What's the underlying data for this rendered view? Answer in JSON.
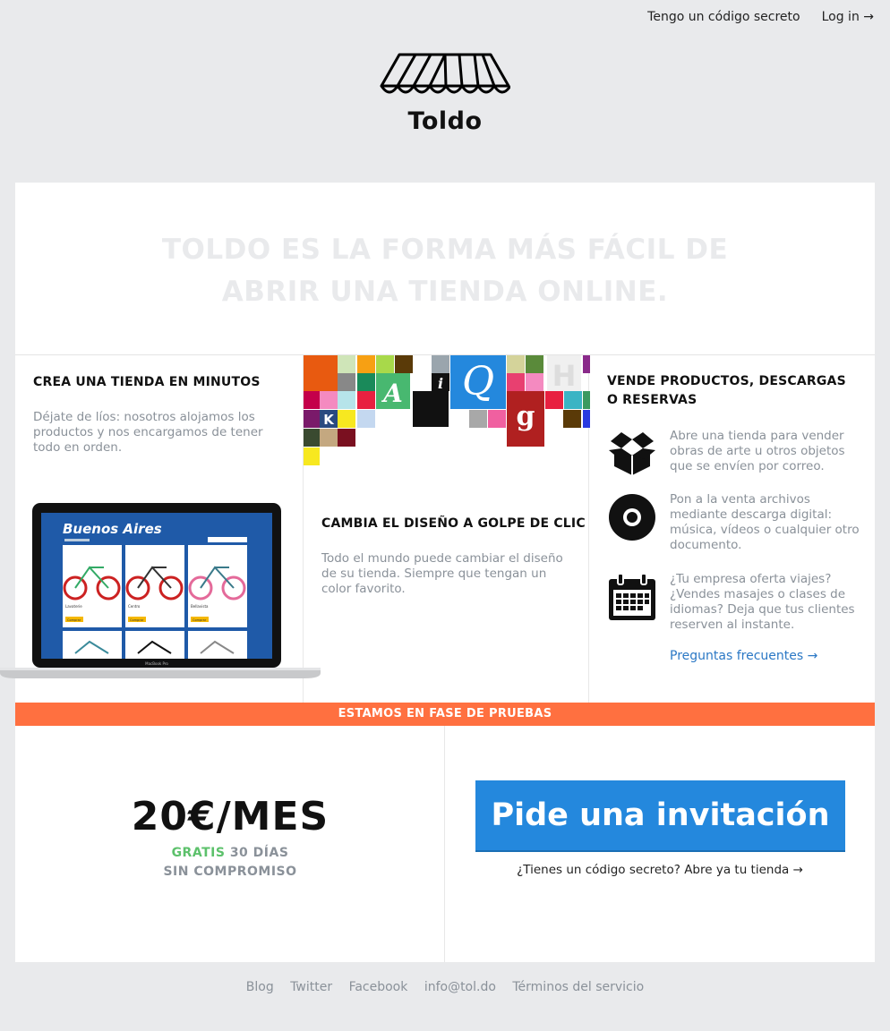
{
  "nav": {
    "secret_code": "Tengo un código secreto",
    "login": "Log in →"
  },
  "brand": {
    "name": "Toldo"
  },
  "hero": {
    "line1": "TOLDO ES LA FORMA MÁS FÁCIL DE",
    "line2": "ABRIR UNA TIENDA ONLINE."
  },
  "features": {
    "create": {
      "title": "CREA UNA TIENDA EN MINUTOS",
      "text": "Déjate de líos: nosotros alojamos los productos y nos encargamos de tener todo en orden."
    },
    "design": {
      "title": "CAMBIA EL DISEÑO A GOLPE DE CLIC",
      "text": "Todo el mundo puede cambiar el diseño de su tienda. Siempre que tengan un color favorito."
    },
    "sell": {
      "title": "VENDE PRODUCTOS, DESCARGAS O RESERVAS",
      "items": [
        {
          "icon": "box-icon",
          "text": "Abre una tienda para vender obras de arte u otros objetos que se envíen por correo."
        },
        {
          "icon": "disc-icon",
          "text": "Pon a la venta archivos mediante descarga digital: música, vídeos o cualquier otro documento."
        },
        {
          "icon": "calendar-icon",
          "text": "¿Tu empresa oferta viajes? ¿Vendes masajes o clases de idiomas? Deja que tus clientes reserven al instante."
        }
      ],
      "faq": "Preguntas frecuentes →"
    }
  },
  "laptop": {
    "store_title": "Buenos Aires",
    "products": [
      "Lavaterie",
      "Centro",
      "Bellavista"
    ],
    "button": "Comprar",
    "brand_label": "MacBook Pro"
  },
  "mosaic_letters": [
    "A",
    "i",
    "Q",
    "H",
    "K",
    "g"
  ],
  "band": {
    "text": "ESTAMOS EN FASE DE PRUEBAS"
  },
  "pricing": {
    "price": "20€/MES",
    "free": "GRATIS",
    "days": "30 DÍAS",
    "commitment": "SIN COMPROMISO"
  },
  "cta": {
    "invite": "Pide una invitación",
    "secret": "¿Tienes un código secreto? Abre ya tu tienda →"
  },
  "footer": {
    "links": [
      "Blog",
      "Twitter",
      "Facebook",
      "info@tol.do",
      "Términos del servicio"
    ]
  },
  "colors": {
    "band": "#ff7040",
    "cta": "#2488dd",
    "link": "#2b78c5",
    "green": "#5cc16b"
  }
}
